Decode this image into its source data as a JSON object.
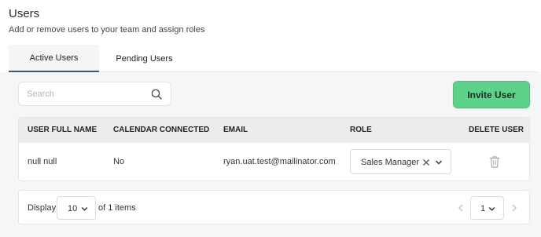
{
  "header": {
    "title": "Users",
    "subtitle": "Add or remove users to your team and assign roles"
  },
  "tabs": [
    {
      "label": "Active Users",
      "active": true
    },
    {
      "label": "Pending Users",
      "active": false
    }
  ],
  "search": {
    "placeholder": "Search",
    "value": "",
    "icon": "search-icon"
  },
  "invite_button": {
    "label": "Invite User",
    "color": "#5ed18a"
  },
  "table": {
    "columns": [
      "USER FULL NAME",
      "CALENDAR CONNECTED",
      "EMAIL",
      "ROLE",
      "DELETE USER"
    ],
    "rows": [
      {
        "full_name": "null null",
        "calendar_connected": "No",
        "email": "ryan.uat.test@mailinator.com",
        "role": "Sales Manager",
        "delete_icon": "trash-icon"
      }
    ]
  },
  "pagination": {
    "display_label": "Display",
    "page_size": "10",
    "items_text": "of 1 items",
    "current_page": "1"
  }
}
